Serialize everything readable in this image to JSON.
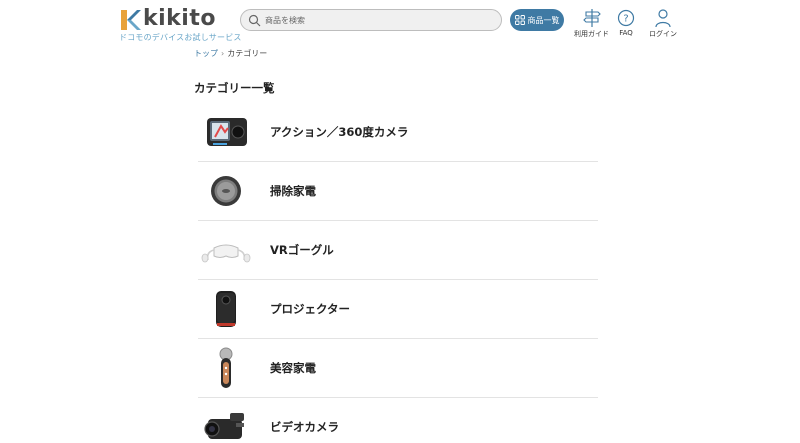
{
  "header": {
    "logo_text": "kikito",
    "logo_sub": "ドコモのデバイスお試しサービス",
    "search_placeholder": "商品を検索",
    "catalog_button": "商品一覧",
    "links": {
      "guide": "利用ガイド",
      "faq": "FAQ",
      "login": "ログイン"
    },
    "accent_color": "#3f7aa4"
  },
  "breadcrumb": {
    "home": "トップ",
    "separator": "›",
    "current": "カテゴリー"
  },
  "page_title": "カテゴリー一覧",
  "categories": [
    {
      "label": "アクション／360度カメラ",
      "icon": "action-camera-icon"
    },
    {
      "label": "掃除家電",
      "icon": "robot-vacuum-icon"
    },
    {
      "label": "VRゴーグル",
      "icon": "vr-headset-icon"
    },
    {
      "label": "プロジェクター",
      "icon": "projector-icon"
    },
    {
      "label": "美容家電",
      "icon": "beauty-device-icon"
    },
    {
      "label": "ビデオカメラ",
      "icon": "video-camera-icon"
    }
  ]
}
